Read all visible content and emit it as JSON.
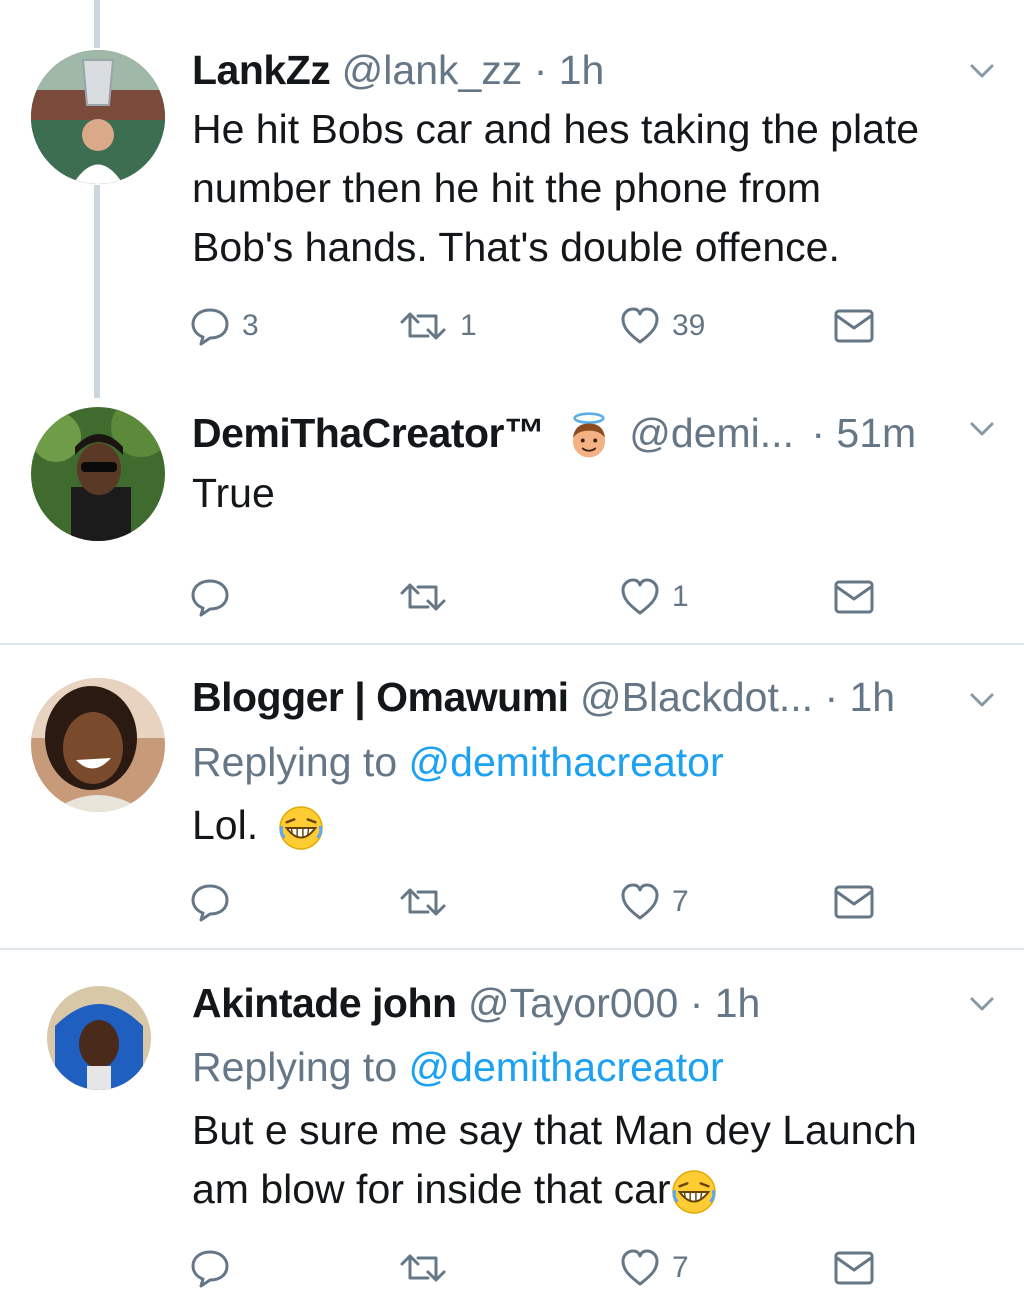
{
  "tweets": [
    {
      "name": "LankZz",
      "handle": "@lank_zz",
      "time": "· 1h",
      "lines": [
        "He hit Bobs car and hes taking the plate",
        "number then he hit the phone from",
        "Bob's hands. That's double offence."
      ],
      "reply_count": "3",
      "retweet_count": "1",
      "like_count": "39"
    },
    {
      "name": "DemiThaCreator™",
      "handle": "@demi...",
      "time": "· 51m",
      "lines": [
        "True"
      ],
      "reply_count": "",
      "retweet_count": "",
      "like_count": "1"
    },
    {
      "name": "Blogger | Omawumi",
      "handle": "@Blackdot...",
      "time": "· 1h",
      "replying_prefix": "Replying to",
      "replying_handle": "@demithacreator",
      "lines": [
        "Lol."
      ],
      "reply_count": "",
      "retweet_count": "",
      "like_count": "7"
    },
    {
      "name": "Akintade john",
      "handle": "@Tayor000",
      "time": "· 1h",
      "replying_prefix": "Replying to",
      "replying_handle": "@demithacreator",
      "lines": [
        "But e sure me say that Man dey Launch",
        "am blow for inside that car"
      ],
      "reply_count": "",
      "retweet_count": "",
      "like_count": "7"
    }
  ],
  "colors": {
    "text": "#14171a",
    "muted": "#657786",
    "link": "#1da1f2",
    "divider": "#e1e8ed",
    "thread": "#ccd6dd"
  },
  "icons": [
    "reply-icon",
    "retweet-icon",
    "like-icon",
    "direct-message-icon",
    "chevron-down-icon",
    "halo-face-emoji",
    "laughing-emoji"
  ]
}
